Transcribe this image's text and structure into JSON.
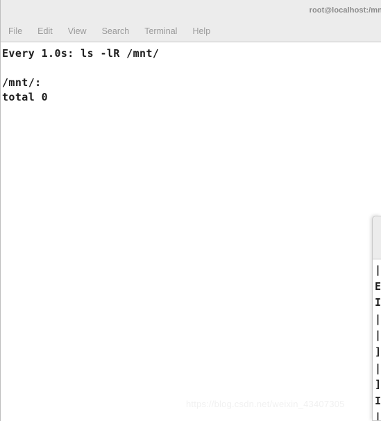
{
  "main_window": {
    "title": "root@localhost:/mn",
    "menu": [
      {
        "label": "File"
      },
      {
        "label": "Edit"
      },
      {
        "label": "View"
      },
      {
        "label": "Search"
      },
      {
        "label": "Terminal"
      },
      {
        "label": "Help"
      }
    ],
    "terminal_lines": [
      "Every 1.0s: ls -lR /mnt/",
      "",
      "/mnt/:",
      "total 0"
    ]
  },
  "background_window": {
    "title": "",
    "terminal_lines": [
      "|",
      "E",
      "I",
      "|",
      "|",
      "]",
      "|",
      "]",
      "I",
      "|"
    ]
  },
  "watermark": {
    "text": "https://blog.csdn.net/weixin_43407305"
  },
  "colors": {
    "header_bg": "#ececec",
    "terminal_bg": "#ffffff",
    "terminal_text": "#1c1c1c",
    "menu_text": "#9a9a9a",
    "title_text": "#8b8b8b",
    "watermark_text": "#f1f1f1",
    "window_border": "#bdbdbd"
  }
}
